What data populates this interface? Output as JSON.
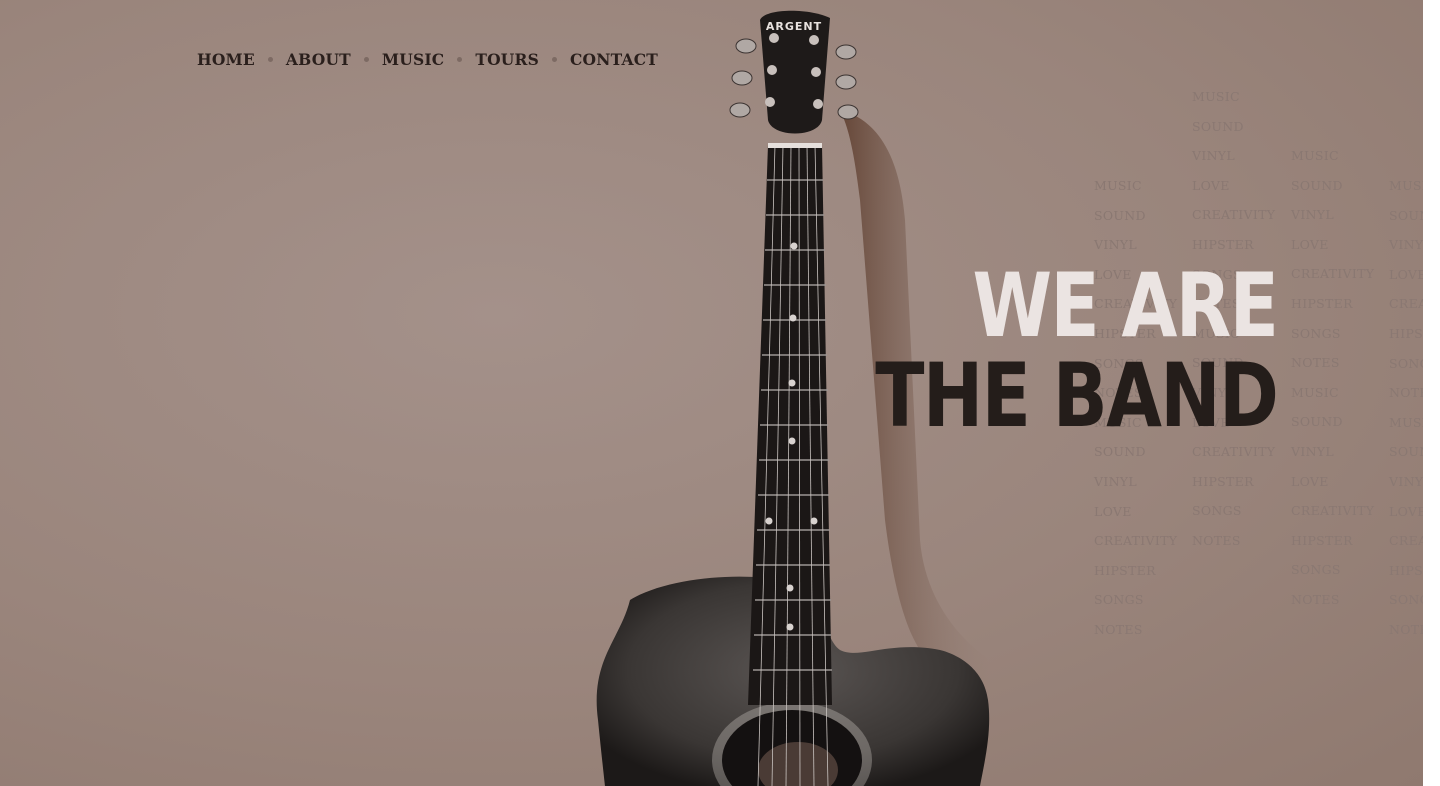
{
  "nav": {
    "items": [
      {
        "label": "HOME"
      },
      {
        "label": "ABOUT"
      },
      {
        "label": "MUSIC"
      },
      {
        "label": "TOURS"
      },
      {
        "label": "CONTACT"
      }
    ]
  },
  "hero": {
    "headline_line1": "WE ARE",
    "headline_line2": "THE BAND",
    "guitar_brand": "ARGENT"
  },
  "word_cloud": {
    "columns": [
      [
        "MUSIC",
        "SOUND",
        "VINYL",
        "LOVE",
        "CREATIVITY",
        "HIPSTER",
        "SONGS",
        "NOTES",
        "MUSIC",
        "SOUND",
        "VINYL",
        "LOVE",
        "CREATIVITY",
        "HIPSTER",
        "SONGS",
        "NOTES"
      ],
      [
        "MUSIC",
        "SOUND",
        "VINYL",
        "LOVE",
        "CREATIVITY",
        "HIPSTER",
        "SONGS",
        "NOTES",
        "MUSIC",
        "SOUND",
        "VINYL",
        "LOVE",
        "CREATIVITY",
        "HIPSTER",
        "SONGS",
        "NOTES"
      ],
      [
        "MUSIC",
        "SOUND",
        "VINYL",
        "LOVE",
        "CREATIVITY",
        "HIPSTER",
        "SONGS",
        "NOTES",
        "MUSIC",
        "SOUND",
        "VINYL",
        "LOVE",
        "CREATIVITY",
        "HIPSTER",
        "SONGS",
        "NOTES"
      ],
      [
        "MUSIC",
        "SOUND",
        "VINYL",
        "LOVE",
        "CREATIVITY",
        "HIPSTER",
        "SONGS",
        "NOTES",
        "MUSIC",
        "SOUND",
        "VINYL",
        "LOVE",
        "CREATIVITY",
        "HIPSTER",
        "SONGS",
        "NOTES"
      ]
    ]
  },
  "colors": {
    "background": "#9a857c",
    "nav_text": "#2a1f1c",
    "headline_light": "#ebe4e2",
    "headline_dark": "#241d1a"
  }
}
